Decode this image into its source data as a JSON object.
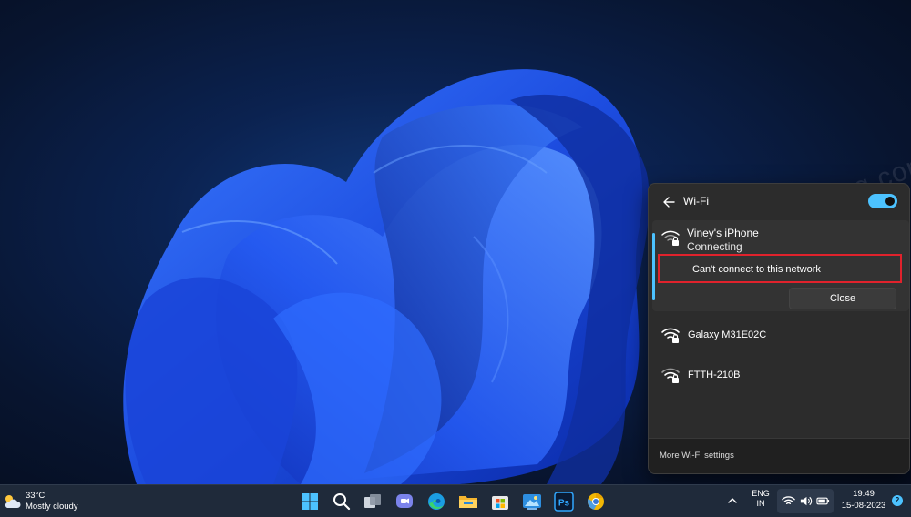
{
  "watermark": "geekermag.com",
  "wifi_panel": {
    "title": "Wi-Fi",
    "toggle_on": true,
    "accent_color": "#4cc2ff",
    "networks": [
      {
        "name": "Viney's iPhone",
        "status": "Connecting",
        "secured": true
      },
      {
        "name": "Galaxy M31E02C",
        "secured": true
      },
      {
        "name": "FTTH-210B",
        "secured": true
      }
    ],
    "error_message": "Can't connect to this network",
    "close_label": "Close",
    "more_settings_label": "More Wi-Fi settings"
  },
  "taskbar": {
    "weather": {
      "temp": "33°C",
      "desc": "Mostly cloudy",
      "icon": "partly-cloudy-icon"
    },
    "apps": [
      "windows-start-icon",
      "search-icon",
      "task-view-icon",
      "teams-chat-icon",
      "edge-icon",
      "file-explorer-icon",
      "microsoft-store-icon",
      "photos-icon",
      "photoshop-icon",
      "chrome-canary-icon"
    ],
    "photoshop_label": "Ps",
    "language": {
      "line1": "ENG",
      "line2": "IN"
    },
    "clock": {
      "time": "19:49",
      "date": "15-08-2023"
    },
    "notification_count": "2"
  }
}
